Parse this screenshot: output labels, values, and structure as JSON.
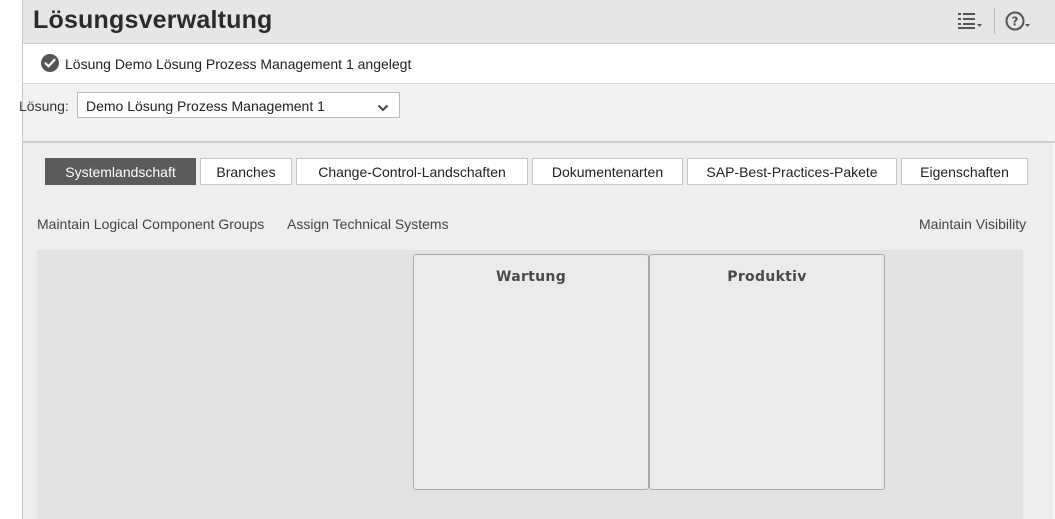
{
  "header": {
    "title": "Lösungsverwaltung",
    "icons": [
      "list-menu-icon",
      "help-icon"
    ]
  },
  "message": {
    "icon": "success-check-icon",
    "text": "Lösung Demo Lösung Prozess Management 1 angelegt"
  },
  "solution": {
    "label": "Lösung:",
    "selected": "Demo Lösung Prozess Management 1"
  },
  "tabs": [
    {
      "label": "Systemlandschaft",
      "active": true
    },
    {
      "label": "Branches",
      "active": false
    },
    {
      "label": "Change-Control-Landschaften",
      "active": false
    },
    {
      "label": "Dokumentenarten",
      "active": false
    },
    {
      "label": "SAP-Best-Practices-Pakete",
      "active": false
    },
    {
      "label": "Eigenschaften",
      "active": false
    }
  ],
  "actions": {
    "maintain_groups": "Maintain Logical Component Groups",
    "assign_systems": "Assign Technical Systems",
    "maintain_visibility": "Maintain Visibility"
  },
  "panels": [
    {
      "title": "Wartung"
    },
    {
      "title": "Produktiv"
    }
  ],
  "colors": {
    "active_tab": "#5b5b5b",
    "background": "#eeeeee",
    "success": "#555555"
  }
}
